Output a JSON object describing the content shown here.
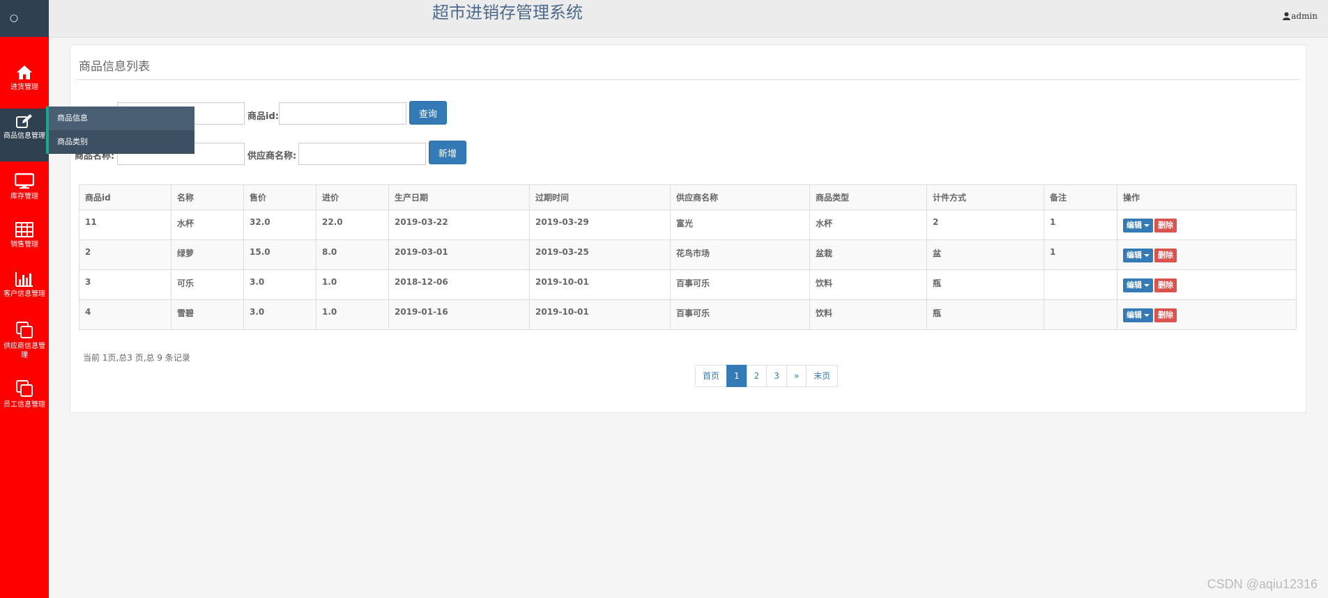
{
  "app_title": "超市进销存管理系统",
  "logo_glyph": "○",
  "user_name": "admin",
  "sidebar": {
    "items": [
      {
        "label": "进货管理",
        "icon": "home-icon"
      },
      {
        "label": "商品信息管理",
        "icon": "edit-icon"
      },
      {
        "label": "库存管理",
        "icon": "monitor-icon"
      },
      {
        "label": "销售管理",
        "icon": "table-icon"
      },
      {
        "label": "客户信息管理",
        "icon": "bar-chart-icon"
      },
      {
        "label": "供应商信息管理",
        "icon": "copy-icon"
      },
      {
        "label": "员工信息管理",
        "icon": "copy-icon"
      }
    ],
    "submenu": [
      "商品信息",
      "商品类别"
    ]
  },
  "panel": {
    "title": "商品信息列表",
    "filters": {
      "id_label": "商品id:",
      "name_label": "商品名称:",
      "supplier_label": "供应商名称:",
      "query_button": "查询",
      "add_button": "新增"
    }
  },
  "table": {
    "headers": [
      "商品id",
      "名称",
      "售价",
      "进价",
      "生产日期",
      "过期时间",
      "供应商名称",
      "商品类型",
      "计件方式",
      "备注",
      "操作"
    ],
    "rows": [
      [
        "11",
        "水杯",
        "32.0",
        "22.0",
        "2019-03-22",
        "2019-03-29",
        "富光",
        "水杯",
        "2",
        "1"
      ],
      [
        "2",
        "绿萝",
        "15.0",
        "8.0",
        "2019-03-01",
        "2019-03-25",
        "花鸟市场",
        "盆栽",
        "盆",
        "1"
      ],
      [
        "3",
        "可乐",
        "3.0",
        "1.0",
        "2018-12-06",
        "2019-10-01",
        "百事可乐",
        "饮料",
        "瓶",
        ""
      ],
      [
        "4",
        "雪碧",
        "3.0",
        "1.0",
        "2019-01-16",
        "2019-10-01",
        "百事可乐",
        "饮料",
        "瓶",
        ""
      ]
    ],
    "edit_label": "编辑",
    "delete_label": "删除"
  },
  "pagination": {
    "info": "当前 1页,总3 页,总 9 条记录",
    "first": "首页",
    "pages": [
      "1",
      "2",
      "3"
    ],
    "next": "»",
    "last": "末页",
    "current": "1"
  },
  "watermark": "CSDN @aqiu12316",
  "colors": {
    "sidebar": "#ff0000",
    "primary": "#337ab7",
    "danger": "#d9534f",
    "header": "#2f4050"
  }
}
